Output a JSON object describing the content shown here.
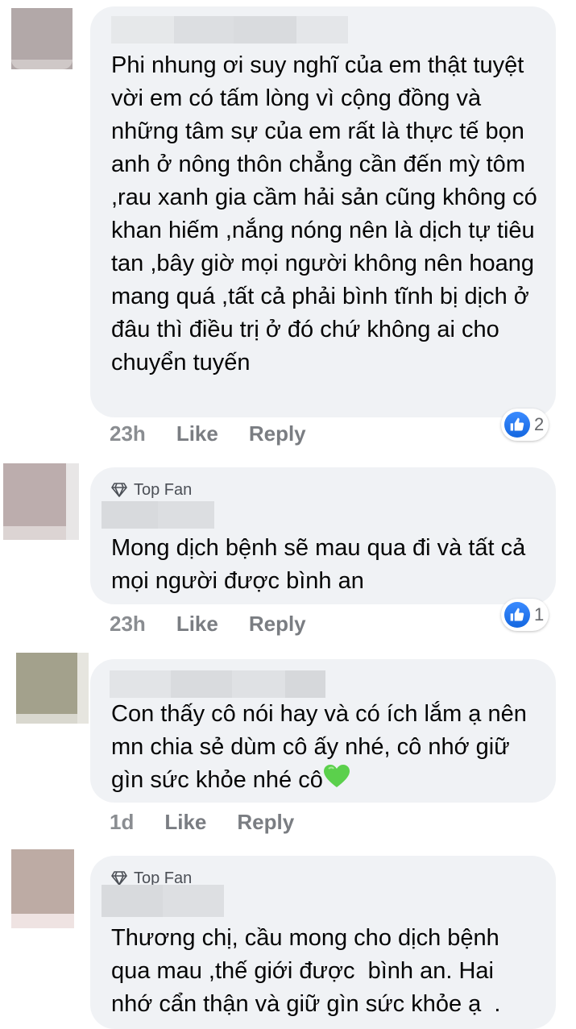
{
  "comments": [
    {
      "top_fan": "",
      "text": "Phi nhung ơi suy nghĩ của em thật tuyệt vời em có tấm lòng vì cộng đồng và những tâm sự của em rất là thực tế bọn anh ở nông thôn chẳng cần đến mỳ tôm ,rau xanh gia cầm hải sản cũng không có khan hiếm ,nắng nóng nên là dịch tự tiêu tan ,bây giờ mọi người không nên hoang mang quá ,tất cả phải bình tĩnh bị dịch ở đâu thì điều trị ở đó chứ không ai cho chuyển tuyến",
      "time": "23h",
      "like_label": "Like",
      "reply_label": "Reply",
      "reaction_count": "2",
      "reaction_icon": "like-icon"
    },
    {
      "top_fan": "Top Fan",
      "text": "Mong dịch bệnh sẽ mau qua đi và tất cả mọi người được bình an",
      "time": "23h",
      "like_label": "Like",
      "reply_label": "Reply",
      "reaction_count": "1",
      "reaction_icon": "like-icon"
    },
    {
      "top_fan": "",
      "text": "Con thấy cô nói hay và có ích lắm ạ nên mn chia sẻ dùm cô ấy nhé, cô nhớ giữ gìn sức khỏe nhé cô",
      "emoji": "green-heart-icon",
      "time": "1d",
      "like_label": "Like",
      "reply_label": "Reply"
    },
    {
      "top_fan": "Top Fan",
      "text": "Thương chị, cầu mong cho dịch bệnh qua mau ,thế giới được  bình an. Hai nhớ cẩn thận và giữ gìn sức khỏe ạ  ."
    }
  ],
  "colors": {
    "bubble": "#f0f2f5",
    "action_text": "#7a7d82",
    "like_blue": "#1877f2",
    "green_heart": "#5bd04c"
  }
}
